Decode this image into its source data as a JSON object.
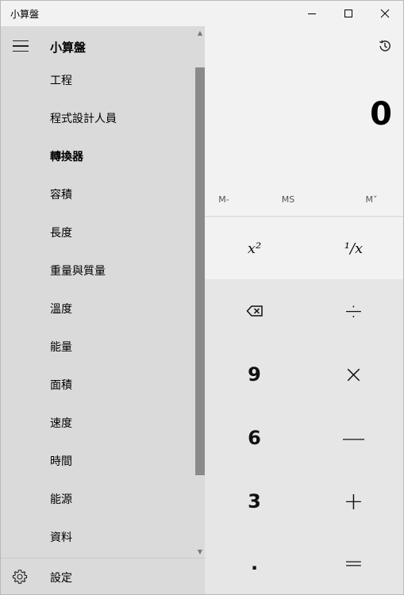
{
  "window": {
    "title": "小算盤",
    "minimize_icon": "minimize-icon",
    "maximize_icon": "maximize-icon",
    "close_icon": "close-icon"
  },
  "nav": {
    "title": "小算盤",
    "menu_icon": "hamburger-icon",
    "items": [
      {
        "label": "工程",
        "type": "item"
      },
      {
        "label": "程式設計人員",
        "type": "item"
      },
      {
        "label": "轉換器",
        "type": "header"
      },
      {
        "label": "容積",
        "type": "item"
      },
      {
        "label": "長度",
        "type": "item"
      },
      {
        "label": "重量與質量",
        "type": "item"
      },
      {
        "label": "溫度",
        "type": "item"
      },
      {
        "label": "能量",
        "type": "item"
      },
      {
        "label": "面積",
        "type": "item"
      },
      {
        "label": "速度",
        "type": "item"
      },
      {
        "label": "時間",
        "type": "item"
      },
      {
        "label": "能源",
        "type": "item"
      },
      {
        "label": "資料",
        "type": "item"
      }
    ],
    "settings_label": "設定",
    "settings_icon": "gear-icon"
  },
  "calculator": {
    "history_icon": "history-icon",
    "display_value": "0",
    "memory": {
      "mminus": "M-",
      "ms": "MS",
      "mlist": "M˅"
    },
    "functions": {
      "square": "x²",
      "reciprocal": "¹/x"
    },
    "keys": {
      "backspace_icon": "backspace-icon",
      "divide": "÷",
      "nine": "9",
      "multiply": "×",
      "six": "6",
      "minus": "—",
      "three": "3",
      "plus": "+",
      "decimal": ".",
      "equals": "="
    }
  }
}
